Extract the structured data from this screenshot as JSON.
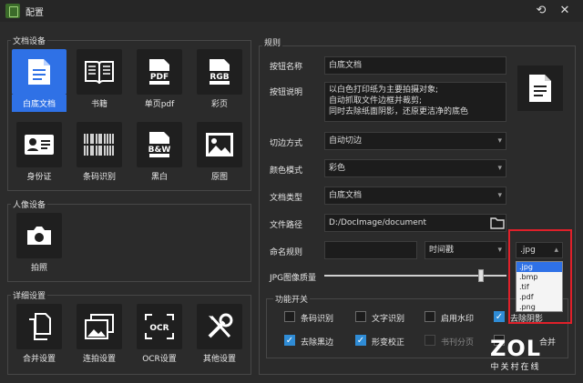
{
  "window": {
    "title": "配置"
  },
  "doc_group": {
    "title": "文档设备",
    "tiles": [
      {
        "label": "白底文档",
        "icon": "document-icon",
        "active": true
      },
      {
        "label": "书籍",
        "icon": "book-icon"
      },
      {
        "label": "单页pdf",
        "icon": "pdf-icon",
        "badge": "PDF"
      },
      {
        "label": "彩页",
        "icon": "rgb-icon",
        "badge": "RGB"
      },
      {
        "label": "身份证",
        "icon": "id-card-icon"
      },
      {
        "label": "条码识别",
        "icon": "barcode-icon"
      },
      {
        "label": "黑白",
        "icon": "bw-icon",
        "badge": "B&W"
      },
      {
        "label": "原图",
        "icon": "image-icon"
      }
    ]
  },
  "portrait_group": {
    "title": "人像设备",
    "tiles": [
      {
        "label": "拍照",
        "icon": "camera-icon"
      }
    ]
  },
  "detail_group": {
    "title": "详细设置",
    "tiles": [
      {
        "label": "合并设置",
        "icon": "copy-icon"
      },
      {
        "label": "连拍设置",
        "icon": "gallery-icon"
      },
      {
        "label": "OCR设置",
        "icon": "ocr-icon",
        "badge": "OCR"
      },
      {
        "label": "其他设置",
        "icon": "tools-icon"
      }
    ]
  },
  "rules": {
    "title": "规则",
    "button_name_label": "按钮名称",
    "button_name_value": "白底文档",
    "button_desc_label": "按钮说明",
    "button_desc_lines": [
      "以白色打印纸为主要拍摄对象;",
      "自动抓取文件边框并裁剪;",
      "同时去除纸面阴影，还原更洁净的底色"
    ],
    "crop_label": "切边方式",
    "crop_value": "自动切边",
    "color_label": "颜色模式",
    "color_value": "彩色",
    "doctype_label": "文档类型",
    "doctype_value": "白底文档",
    "path_label": "文件路径",
    "path_value": "D:/DocImage/document",
    "naming_label": "命名规则",
    "naming_value": "",
    "naming_mode": "时间戳",
    "format_value": ".jpg",
    "format_options": [
      ".jpg",
      ".bmp",
      ".tif",
      ".pdf",
      ".png"
    ],
    "quality_label": "JPG图像质量",
    "quality_level": 0.86
  },
  "features": {
    "title": "功能开关",
    "items": [
      {
        "label": "条码识别",
        "checked": false
      },
      {
        "label": "文字识别",
        "checked": false
      },
      {
        "label": "启用水印",
        "checked": false
      },
      {
        "label": "去除阴影",
        "checked": true
      },
      {
        "label": "去除黑边",
        "checked": true
      },
      {
        "label": "形变校正",
        "checked": true
      },
      {
        "label": "书刊分页",
        "checked": false,
        "disabled": true
      },
      {
        "label": "合并",
        "checked": false,
        "partial": true
      }
    ]
  },
  "watermark": {
    "logo": "ZOL",
    "sub": "中关村在线"
  },
  "colors": {
    "accent": "#2f71e6",
    "check": "#2f8cd6",
    "highlight": "#e0202a",
    "bg": "#2b2b2b"
  }
}
